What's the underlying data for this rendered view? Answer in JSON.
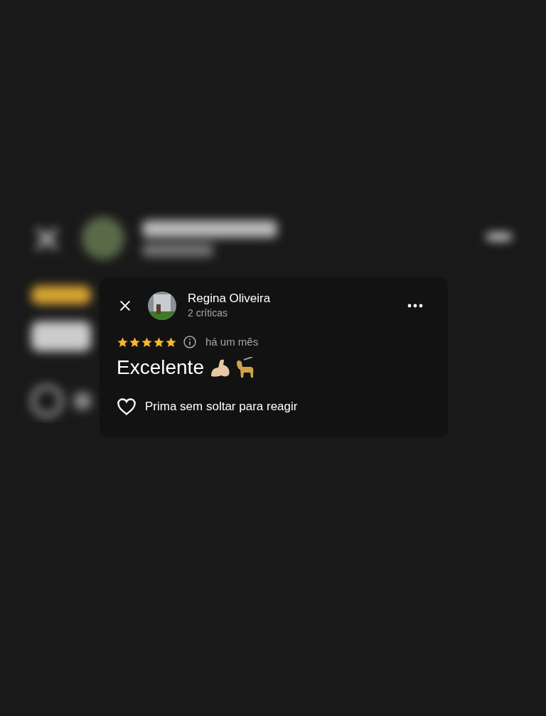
{
  "review": {
    "author": "Regina Oliveira",
    "reviews_count": "2 críticas",
    "stars": 5,
    "time": "há um mês",
    "title": "Excelente",
    "reaction_hint": "Prima sem soltar para reagir"
  }
}
